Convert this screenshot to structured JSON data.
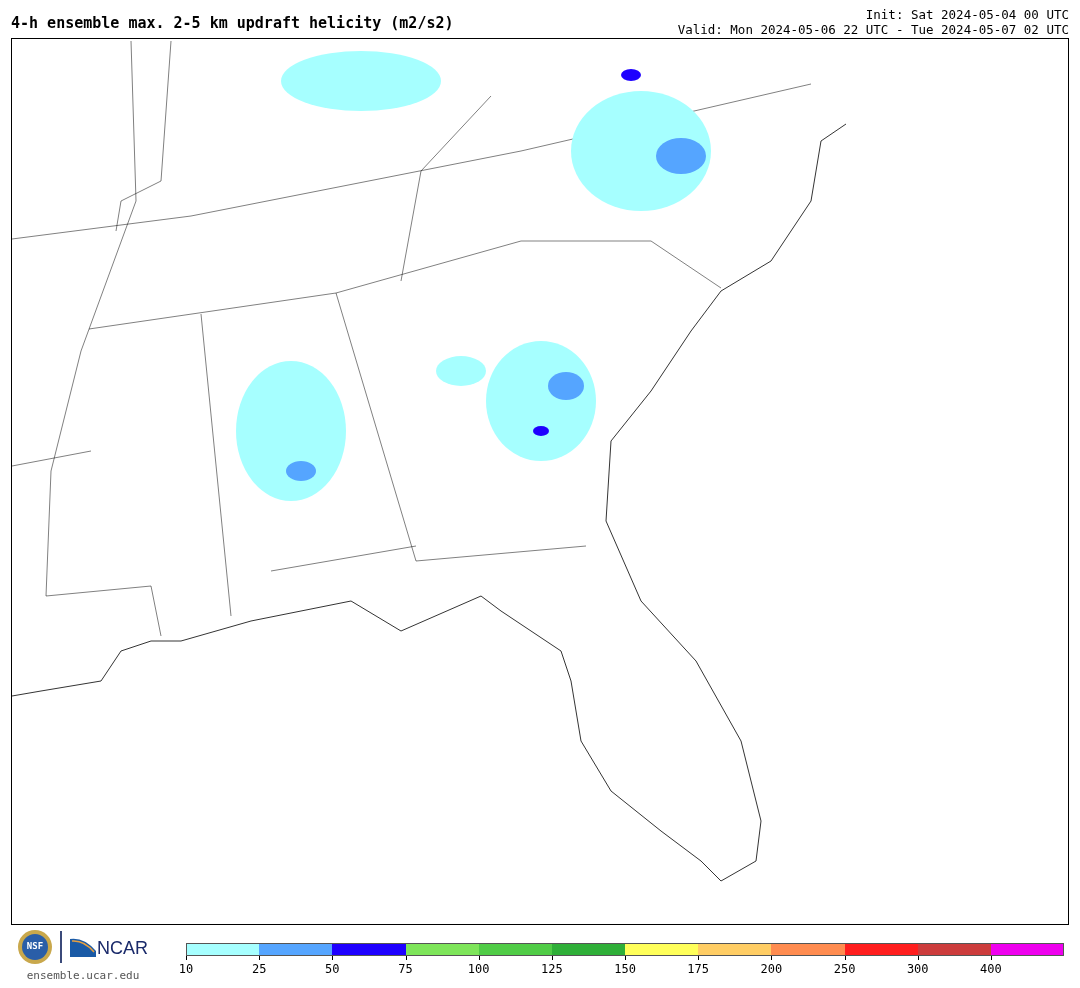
{
  "title": "4-h ensemble max. 2-5 km updraft helicity (m2/s2)",
  "init": "Init: Sat 2024-05-04 00 UTC",
  "valid": "Valid: Mon 2024-05-06 22 UTC - Tue 2024-05-07 02 UTC",
  "logos": {
    "nsf": "NSF",
    "ncar": "NCAR"
  },
  "site": "ensemble.ucar.edu",
  "colorbar": {
    "segments": [
      {
        "label": "10",
        "color": "#a6ffff"
      },
      {
        "label": "25",
        "color": "#55a5ff"
      },
      {
        "label": "50",
        "color": "#1e00ff"
      },
      {
        "label": "75",
        "color": "#7ee55a"
      },
      {
        "label": "100",
        "color": "#50cc46"
      },
      {
        "label": "125",
        "color": "#2faf38"
      },
      {
        "label": "150",
        "color": "#ffff5a"
      },
      {
        "label": "175",
        "color": "#ffcd64"
      },
      {
        "label": "200",
        "color": "#ff8c50"
      },
      {
        "label": "250",
        "color": "#ff1e1e"
      },
      {
        "label": "300",
        "color": "#cc3c3c"
      },
      {
        "label": "400",
        "color": "#ee00ee"
      }
    ]
  }
}
